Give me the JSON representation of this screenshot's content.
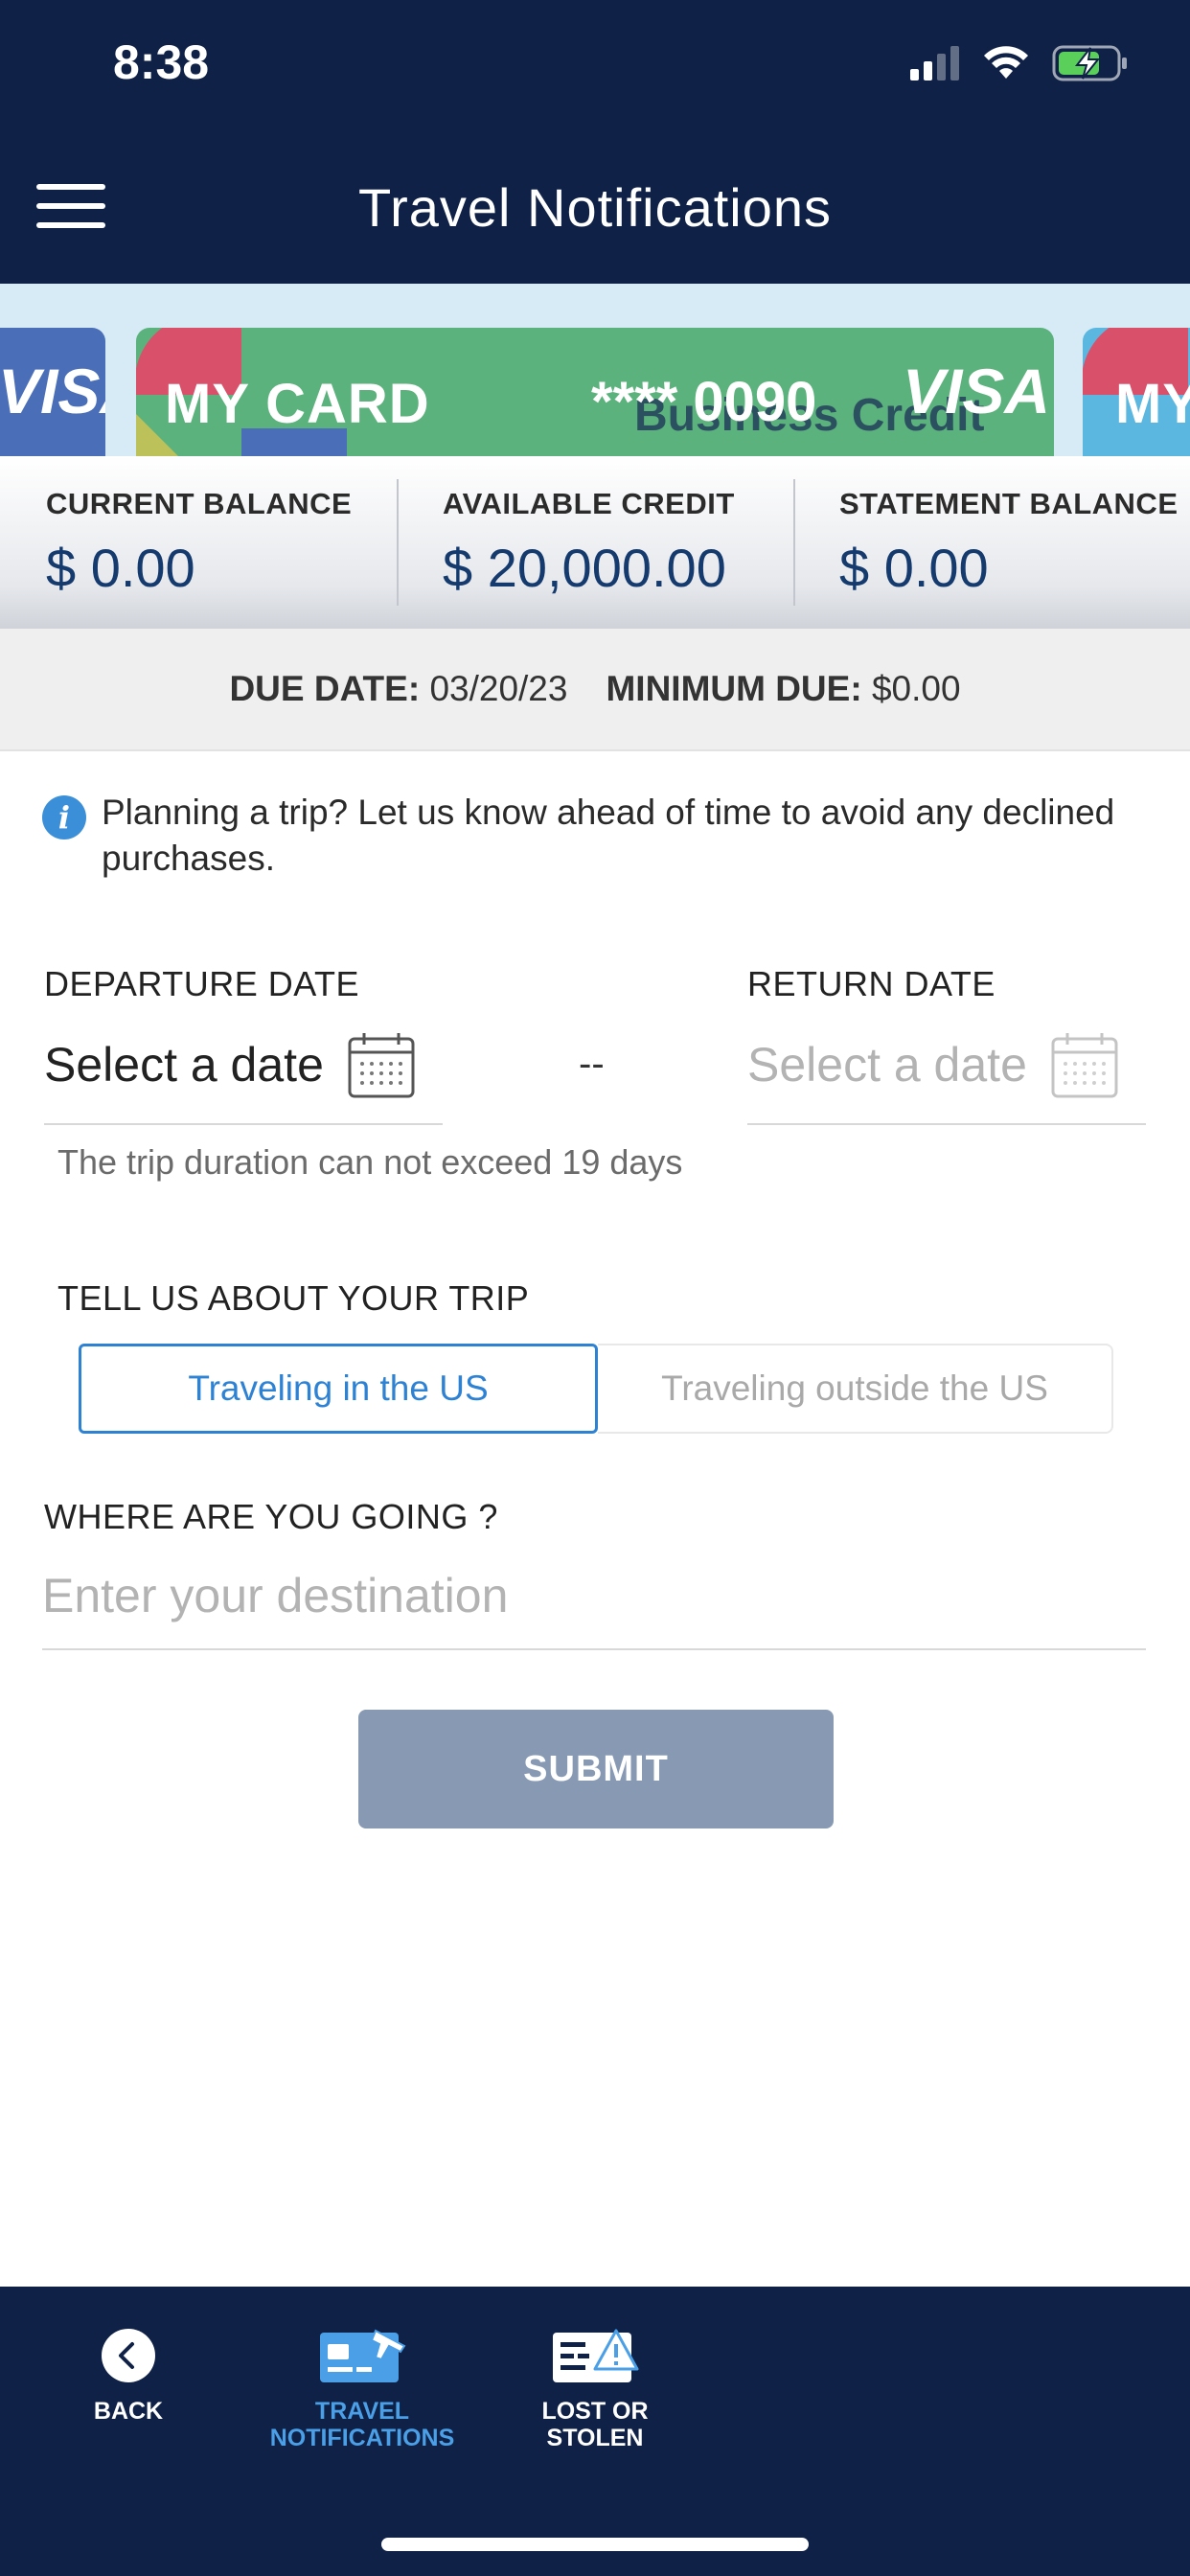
{
  "status_bar": {
    "time": "8:38"
  },
  "header": {
    "title": "Travel Notifications"
  },
  "cards": {
    "left_card_brand": "VISA",
    "main_card": {
      "name": "MY CARD",
      "number": "**** 0090",
      "brand": "VISA",
      "subtitle": "Business Credit"
    },
    "right_card_name": "MY"
  },
  "balances": [
    {
      "label": "CURRENT BALANCE",
      "value": "$ 0.00"
    },
    {
      "label": "AVAILABLE CREDIT",
      "value": "$ 20,000.00"
    },
    {
      "label": "STATEMENT BALANCE",
      "value": "$ 0.00"
    }
  ],
  "due": {
    "due_date_label": "DUE DATE:",
    "due_date_value": "03/20/23",
    "minimum_due_label": "MINIMUM DUE:",
    "minimum_due_value": "$0.00"
  },
  "info": {
    "text": "Planning a trip? Let us know ahead of time to avoid any declined purchases."
  },
  "dates": {
    "departure_label": "DEPARTURE DATE",
    "departure_value": "Select a date",
    "separator": "--",
    "return_label": "RETURN DATE",
    "return_value": "Select a date",
    "hint": "The trip duration can not exceed 19 days"
  },
  "trip": {
    "label": "TELL US ABOUT YOUR TRIP",
    "options": [
      "Traveling in the US",
      "Traveling outside the US"
    ],
    "selected": "Traveling in the US"
  },
  "destination": {
    "label": "WHERE ARE YOU GOING ?",
    "placeholder": "Enter your destination",
    "value": ""
  },
  "submit_label": "SUBMIT",
  "bottom_nav": [
    {
      "label": "BACK",
      "icon": "back-icon"
    },
    {
      "label": "TRAVEL NOTIFICATIONS",
      "icon": "travel-card-icon",
      "active": true
    },
    {
      "label": "LOST OR STOLEN",
      "icon": "lost-card-icon"
    }
  ],
  "colors": {
    "navy": "#0f2146",
    "accent": "#2e82d4",
    "card_green": "#5cb27d",
    "submit_disabled": "#8799b3"
  }
}
